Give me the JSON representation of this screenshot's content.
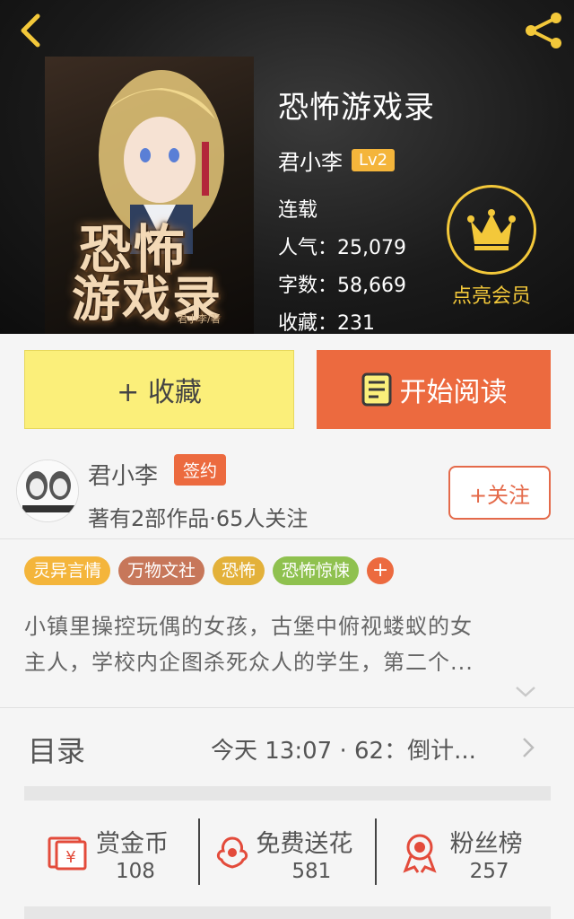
{
  "book": {
    "title": "恐怖游戏录",
    "author": "君小李",
    "level": "Lv2",
    "status": "连载",
    "popularity": "人气：25,079",
    "word_count": "字数：58,669",
    "favorites": "收藏：231",
    "cover_title_1": "恐怖",
    "cover_title_2": "游戏录",
    "cover_author": "君小李/著"
  },
  "vip": {
    "label": "点亮会员"
  },
  "actions": {
    "collect": "+ 收藏",
    "read": "开始阅读"
  },
  "author": {
    "name": "君小李",
    "badge": "签约",
    "summary": "著有2部作品·65人关注",
    "follow": "+关注"
  },
  "tags": [
    {
      "label": "灵异言情",
      "color": "#f4b53b"
    },
    {
      "label": "万物文社",
      "color": "#c7775a"
    },
    {
      "label": "恐怖",
      "color": "#e3b13a"
    },
    {
      "label": "恐怖惊悚",
      "color": "#8fc14f"
    }
  ],
  "tag_more": "+",
  "description": {
    "line1": "小镇里操控玩偶的女孩，古堡中俯视蝼蚁的女",
    "line2": "主人，学校内企图杀死众人的学生，第二个..."
  },
  "toc": {
    "label": "目录",
    "update": "今天 13:07 · 62：倒计..."
  },
  "stats": [
    {
      "label": "赏金币",
      "value": "108",
      "icon": "reward-envelope-icon"
    },
    {
      "label": "免费送花",
      "value": "581",
      "icon": "flower-icon"
    },
    {
      "label": "粉丝榜",
      "value": "257",
      "icon": "medal-icon"
    }
  ],
  "colors": {
    "accent": "#ec6a3f",
    "collect": "#fbef7a",
    "vip": "#f3c83a"
  }
}
